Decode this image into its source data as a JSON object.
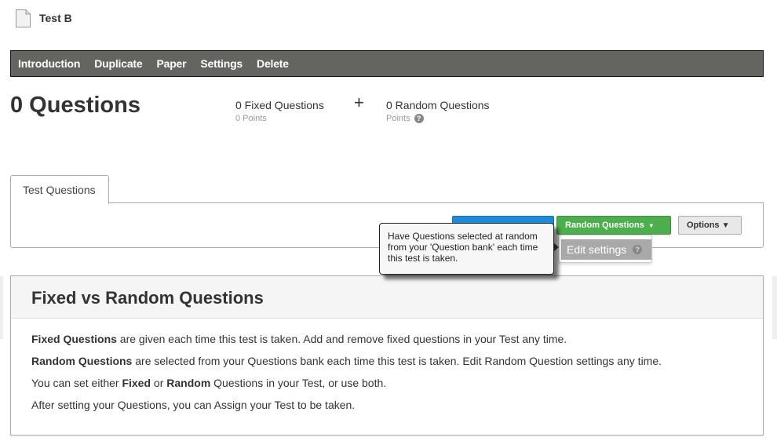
{
  "header": {
    "title": "Test B",
    "icon": "document-icon"
  },
  "nav": {
    "items": [
      "Introduction",
      "Duplicate",
      "Paper",
      "Settings",
      "Delete"
    ]
  },
  "summary": {
    "total": "0 Questions",
    "fixed": {
      "label": "0 Fixed Questions",
      "points": "0 Points"
    },
    "plus": "+",
    "random": {
      "label": "0 Random Questions",
      "points": "Points",
      "help": "?"
    }
  },
  "tabs": [
    {
      "label": "Test Questions",
      "active": true
    }
  ],
  "toolbar": {
    "random_button": "Random Questions",
    "options_button": "Options",
    "caret": "▾",
    "options_caret": "▼"
  },
  "dropdown": {
    "items": [
      {
        "label": "Edit settings",
        "help": "?"
      }
    ]
  },
  "tooltip": {
    "text": "Have Questions selected at random from your 'Question bank' each time this test is taken."
  },
  "info": {
    "title": "Fixed vs Random Questions",
    "lines": [
      {
        "bold": "Fixed Questions",
        "rest": " are given each time this test is taken. Add and remove fixed questions in your Test any time."
      },
      {
        "bold": "Random Questions",
        "rest": " are selected from your Questions bank each time this test is taken. Edit Random Question settings any time."
      },
      {
        "pre": "You can set either ",
        "bold1": "Fixed",
        "mid": " or ",
        "bold2": "Random",
        "post": " Questions in your Test, or use both."
      },
      {
        "text": "After setting your Questions, you can Assign your Test to be taken."
      }
    ]
  },
  "colors": {
    "nav_bg": "#646561",
    "green_button": "#4cae4c",
    "blue_button": "#1c8bd9"
  }
}
